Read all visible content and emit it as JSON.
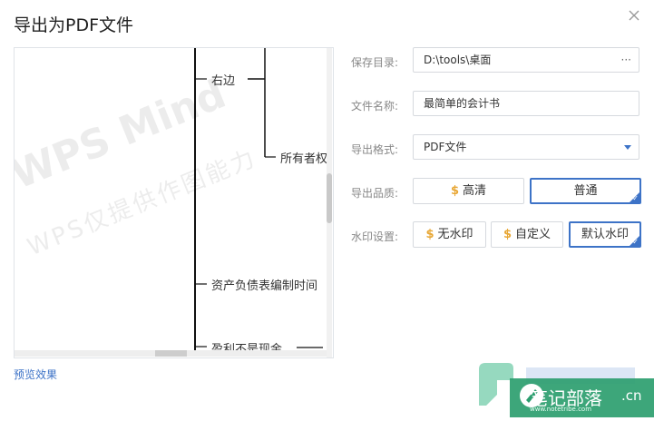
{
  "dialog": {
    "title": "导出为PDF文件"
  },
  "preview": {
    "label": "预览效果",
    "watermark_line1": "WPS Mind",
    "watermark_line2": "WPS仅提供作图能力",
    "nodes": [
      "右边",
      "所有者权",
      "资产负债表编制时间",
      "盈利不是现金"
    ]
  },
  "form": {
    "save_dir": {
      "label": "保存目录:",
      "value": "D:\\tools\\桌面",
      "browse": "···"
    },
    "file_name": {
      "label": "文件名称:",
      "value": "最简单的会计书"
    },
    "export_format": {
      "label": "导出格式:",
      "value": "PDF文件"
    },
    "export_quality": {
      "label": "导出品质:",
      "options": [
        {
          "label": "高清",
          "premium": "$",
          "selected": false
        },
        {
          "label": "普通",
          "selected": true
        }
      ]
    },
    "watermark": {
      "label": "水印设置:",
      "options": [
        {
          "label": "无水印",
          "premium": "$",
          "selected": false
        },
        {
          "label": "自定义",
          "premium": "$",
          "selected": false
        },
        {
          "label": "默认水印",
          "selected": true
        }
      ]
    }
  },
  "site_watermark": {
    "text": "笔记部落",
    "url": "www.notetribe.com",
    "suffix": ".cn"
  },
  "colors": {
    "accent": "#3d73c7",
    "coin": "#e8a735",
    "site_green": "#3fb98a"
  }
}
